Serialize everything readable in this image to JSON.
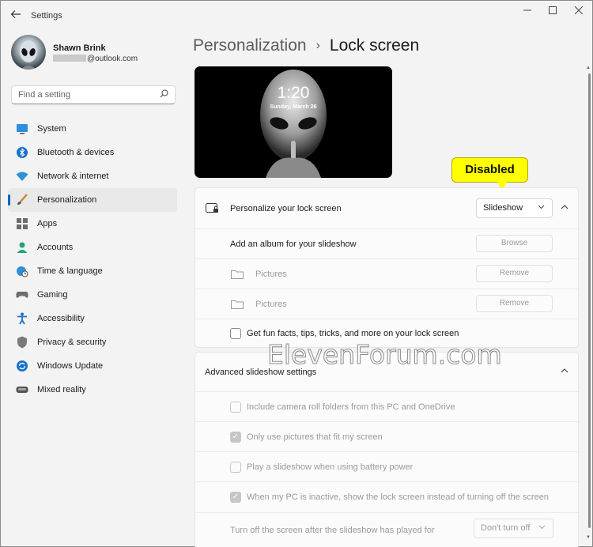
{
  "app": {
    "title": "Settings"
  },
  "user": {
    "name": "Shawn Brink",
    "email": "@outlook.com"
  },
  "search": {
    "placeholder": "Find a setting"
  },
  "nav": [
    {
      "label": "System",
      "icon": "monitor-icon"
    },
    {
      "label": "Bluetooth & devices",
      "icon": "bluetooth-icon"
    },
    {
      "label": "Network & internet",
      "icon": "wifi-icon"
    },
    {
      "label": "Personalization",
      "icon": "brush-icon",
      "selected": true
    },
    {
      "label": "Apps",
      "icon": "apps-icon"
    },
    {
      "label": "Accounts",
      "icon": "person-icon"
    },
    {
      "label": "Time & language",
      "icon": "globe-clock-icon"
    },
    {
      "label": "Gaming",
      "icon": "controller-icon"
    },
    {
      "label": "Accessibility",
      "icon": "accessibility-icon"
    },
    {
      "label": "Privacy & security",
      "icon": "shield-icon"
    },
    {
      "label": "Windows Update",
      "icon": "update-icon"
    },
    {
      "label": "Mixed reality",
      "icon": "headset-icon"
    }
  ],
  "breadcrumb": {
    "parent": "Personalization",
    "current": "Lock screen"
  },
  "preview": {
    "time": "1:20",
    "date": "Sunday, March 26"
  },
  "callout": {
    "text": "Disabled"
  },
  "lockscreen": {
    "label": "Personalize your lock screen",
    "dropdown_value": "Slideshow",
    "album_label": "Add an album for your slideshow",
    "browse_label": "Browse",
    "folders": [
      {
        "name": "Pictures",
        "remove_label": "Remove"
      },
      {
        "name": "Pictures",
        "remove_label": "Remove"
      }
    ],
    "fun_facts_label": "Get fun facts, tips, tricks, and more on your lock screen"
  },
  "advanced": {
    "title": "Advanced slideshow settings",
    "options": [
      {
        "label": "Include camera roll folders from this PC and OneDrive",
        "checked": false
      },
      {
        "label": "Only use pictures that fit my screen",
        "checked": true
      },
      {
        "label": "Play a slideshow when using battery power",
        "checked": false
      },
      {
        "label": "When my PC is inactive, show the lock screen instead of turning off the screen",
        "checked": true
      }
    ],
    "turnoff_label": "Turn off the screen after the slideshow has played for",
    "turnoff_value": "Don't turn off"
  },
  "watermark": "ElevenForum.com"
}
